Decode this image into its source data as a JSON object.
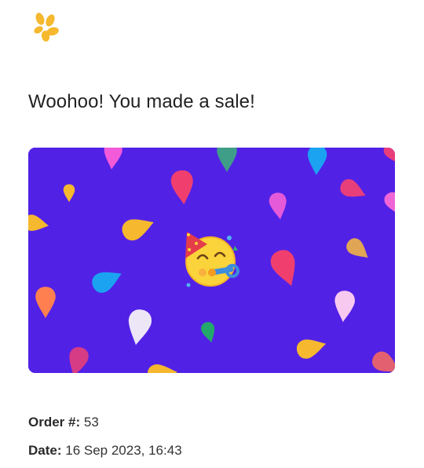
{
  "header": {
    "logo_icon": "confetti-petal-logo-icon",
    "brand_color": "#F5B82E"
  },
  "message": {
    "headline": "Woohoo! You made a sale!"
  },
  "banner": {
    "background_color": "#5221E6",
    "center_icon": "party-face-icon"
  },
  "order": {
    "number_label": "Order #:",
    "number_value": "53",
    "date_label": "Date:",
    "date_value": "16 Sep 2023, 16:43"
  }
}
